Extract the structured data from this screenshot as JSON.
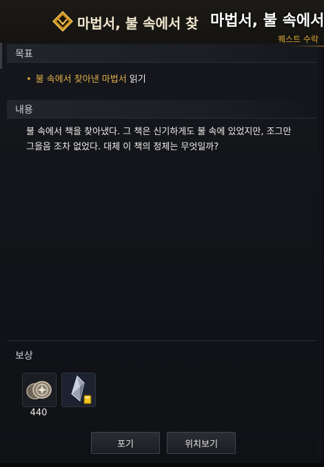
{
  "title": {
    "main": "마법서, 불 속에서 찾",
    "overlay": "마법서, 불 속에서",
    "subtitle": "퀘스트 수락"
  },
  "objective": {
    "heading": "목표",
    "bullet": "•",
    "highlight": "불 속에서 찾아낸 마법서",
    "rest": " 읽기"
  },
  "content": {
    "heading": "내용",
    "text": "불 속에서 책을 찾아냈다. 그 책은 신기하게도 불 속에 있었지만, 조그만 그을음 조차 없었다. 대체 이 책의 정체는 무엇일까?"
  },
  "rewards": {
    "heading": "보상",
    "items": [
      {
        "icon": "silver-coins-icon",
        "count": "440"
      },
      {
        "icon": "crystal-shard-icon",
        "count": ""
      }
    ]
  },
  "buttons": {
    "abandon": "포기",
    "locate": "위치보기"
  },
  "colors": {
    "accent": "#d9a637",
    "highlight": "#e5b04a"
  }
}
